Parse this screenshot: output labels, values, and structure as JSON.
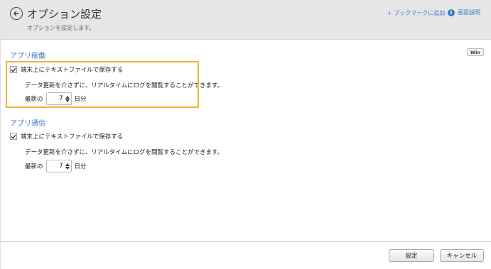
{
  "header": {
    "title": "オプション設定",
    "subtitle": "オプションを設定します。",
    "bookmark_label": "+ ブックマークに追加",
    "help_label": "画面説明",
    "help_icon_glyph": "i"
  },
  "platform_badge": "Win",
  "sections": [
    {
      "title": "アプリ稼働",
      "checkbox_label": "端末上にテキストファイルで保存する",
      "checked": true,
      "description": "データ更新を介さずに、リアルタイムにログを閲覧することができます。",
      "days_prefix": "最新の",
      "days_value": "7",
      "days_suffix": "日分"
    },
    {
      "title": "アプリ通信",
      "checkbox_label": "端末上にテキストファイルで保存する",
      "checked": true,
      "description": "データ更新を介さずに、リアルタイムにログを閲覧することができます。",
      "days_prefix": "最新の",
      "days_value": "7",
      "days_suffix": "日分"
    }
  ],
  "footer": {
    "save_label": "設定",
    "cancel_label": "キャンセル"
  },
  "colors": {
    "accent": "#3a78c2",
    "highlight": "#f0b53c",
    "header_bg": "#e6e6e6"
  }
}
